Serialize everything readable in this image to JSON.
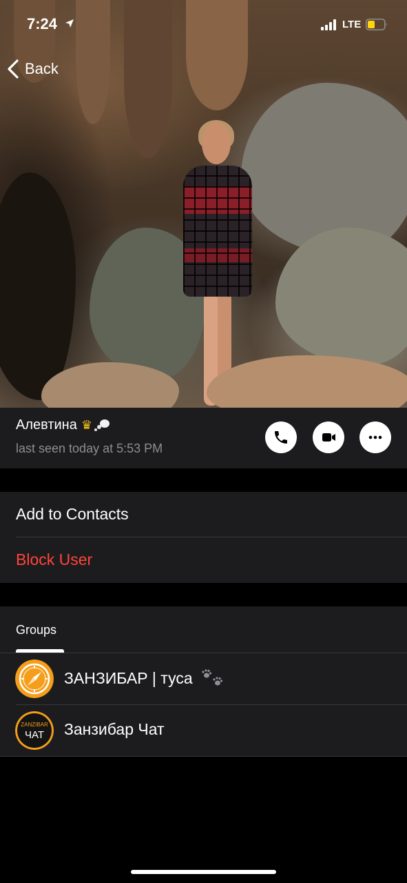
{
  "status_bar": {
    "time": "7:24",
    "network": "LTE",
    "location_icon": "location-arrow-icon",
    "battery_color": "#ffd60a"
  },
  "nav": {
    "back_label": "Back"
  },
  "profile": {
    "name": "Алевтина",
    "name_emojis": [
      "crown-icon",
      "thought-bubble-icon"
    ],
    "last_seen": "last seen today at 5:53 PM",
    "actions": [
      "phone-icon",
      "video-camera-icon",
      "more-icon"
    ]
  },
  "actions_list": {
    "add_to_contacts": "Add to Contacts",
    "block_user": "Block User",
    "block_color": "#ff453a"
  },
  "groups": {
    "label": "Groups",
    "items": [
      {
        "name": "ЗАНЗИБАР | туса",
        "suffix_icon": "paw-prints-icon",
        "avatar": "compass-logo"
      },
      {
        "name": "Занзибар Чат",
        "avatar": "zanzibar-chat-logo",
        "avatar_text_top": "ZANZIBAR",
        "avatar_text_bottom": "ЧАТ"
      }
    ]
  },
  "colors": {
    "background": "#000000",
    "card": "#1c1c1e",
    "secondary_text": "#8e8e93",
    "accent_orange": "#f59e1b"
  }
}
